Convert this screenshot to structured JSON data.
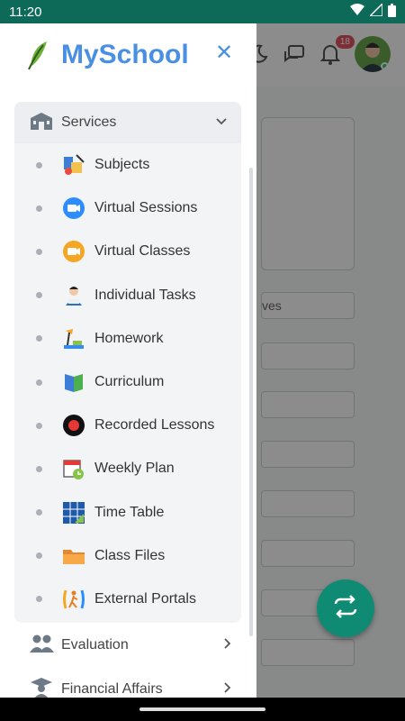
{
  "status_bar": {
    "time": "11:20"
  },
  "drawer": {
    "brand": "MySchool",
    "services": {
      "label": "Services",
      "items": [
        {
          "label": "Subjects",
          "icon": "subjects-icon"
        },
        {
          "label": "Virtual Sessions",
          "icon": "video-camera-icon"
        },
        {
          "label": "Virtual Classes",
          "icon": "video-camera-icon"
        },
        {
          "label": "Individual Tasks",
          "icon": "student-reading-icon"
        },
        {
          "label": "Homework",
          "icon": "desk-lamp-icon"
        },
        {
          "label": "Curriculum",
          "icon": "book-icon"
        },
        {
          "label": "Recorded Lessons",
          "icon": "record-icon"
        },
        {
          "label": "Weekly Plan",
          "icon": "calendar-clock-icon"
        },
        {
          "label": "Time Table",
          "icon": "timetable-icon"
        },
        {
          "label": "Class Files",
          "icon": "folder-icon"
        },
        {
          "label": "External Portals",
          "icon": "portal-icon"
        }
      ]
    },
    "evaluation": {
      "label": "Evaluation"
    },
    "financial": {
      "label": "Financial Affairs"
    }
  },
  "background": {
    "notification_count": "18",
    "field_text": "ves"
  },
  "colors": {
    "brand": "#4a90e2",
    "status_bar": "#0d6a59",
    "fab": "#0f8a73"
  }
}
